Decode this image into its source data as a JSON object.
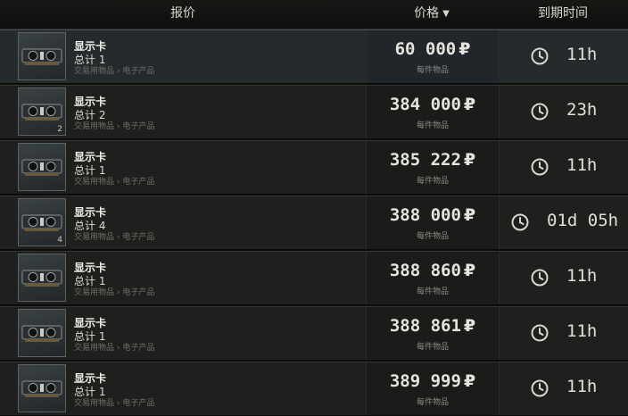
{
  "header": {
    "offer": "报价",
    "price": "价格",
    "expire": "到期时间"
  },
  "price_unit": "₽",
  "price_sub": "每件物品",
  "category": "交易用物品 › 电子产品",
  "rows": [
    {
      "name": "显示卡",
      "total": "总计 1",
      "qty": "",
      "price": "60 000",
      "expire": "11h",
      "selected": true
    },
    {
      "name": "显示卡",
      "total": "总计 2",
      "qty": "2",
      "price": "384 000",
      "expire": "23h",
      "selected": false
    },
    {
      "name": "显示卡",
      "total": "总计 1",
      "qty": "",
      "price": "385 222",
      "expire": "11h",
      "selected": false
    },
    {
      "name": "显示卡",
      "total": "总计 4",
      "qty": "4",
      "price": "388 000",
      "expire": "01d 05h",
      "selected": false
    },
    {
      "name": "显示卡",
      "total": "总计 1",
      "qty": "",
      "price": "388 860",
      "expire": "11h",
      "selected": false
    },
    {
      "name": "显示卡",
      "total": "总计 1",
      "qty": "",
      "price": "388 861",
      "expire": "11h",
      "selected": false
    },
    {
      "name": "显示卡",
      "total": "总计 1",
      "qty": "",
      "price": "389 999",
      "expire": "11h",
      "selected": false
    }
  ]
}
